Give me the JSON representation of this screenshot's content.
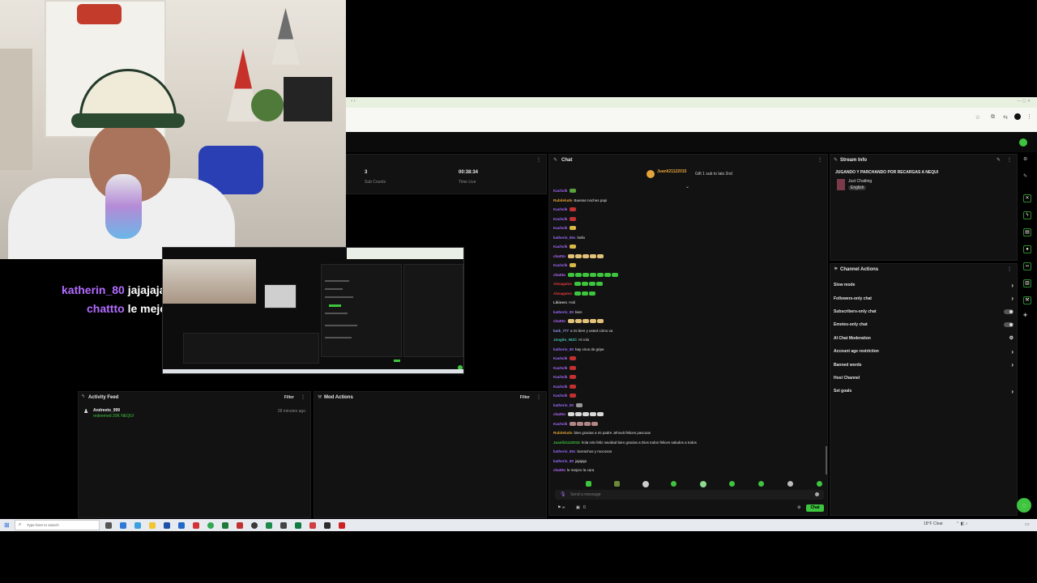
{
  "overlay_chat": [
    {
      "user": "katherin_80",
      "message": "jajajajaja"
    },
    {
      "user": "chattto",
      "message": "le mejoro la cara"
    }
  ],
  "stats": {
    "sub_count_value": "3",
    "sub_count_label": "Sub Counts",
    "time_live_value": "00:38:34",
    "time_live_label": "Time Live"
  },
  "chat": {
    "title": "Chat",
    "pinned_user": "Juanli21122015",
    "pinned_text": "Gift 1 sub to lats 2nd",
    "input_placeholder": "Send a message",
    "send_label": "Chat",
    "viewer_count": "0",
    "messages": [
      {
        "user": "Kachclk",
        "color": "#a66bff",
        "text": "",
        "emotes": [
          "#5aa33b"
        ]
      },
      {
        "user": "Rubiteludo",
        "color": "#e5a43a",
        "text": "Buenas noches papi",
        "emotes": []
      },
      {
        "user": "Kachclk",
        "color": "#a66bff",
        "text": "",
        "emotes": [
          "#c23030"
        ]
      },
      {
        "user": "Kachclk",
        "color": "#a66bff",
        "text": "",
        "emotes": [
          "#c23030"
        ]
      },
      {
        "user": "Kachclk",
        "color": "#a66bff",
        "text": "",
        "emotes": [
          "#d8b948"
        ]
      },
      {
        "user": "katherin_80c",
        "color": "#9a6cff",
        "text": "hello",
        "emotes": []
      },
      {
        "user": "Kachclk",
        "color": "#a66bff",
        "text": "",
        "emotes": [
          "#d8b948"
        ]
      },
      {
        "user": "chattto",
        "color": "#b36cff",
        "text": "",
        "emotes": [
          "#e2c27a",
          "#e2c27a",
          "#e2c27a",
          "#e2c27a",
          "#e2c27a"
        ]
      },
      {
        "user": "Kachclk",
        "color": "#a66bff",
        "text": "",
        "emotes": [
          "#d8b948"
        ]
      },
      {
        "user": "chattto",
        "color": "#b36cff",
        "text": "",
        "emotes": [
          "#3ec43e",
          "#3ec43e",
          "#3ec43e",
          "#3ec43e",
          "#3ec43e",
          "#3ec43e",
          "#3ec43e"
        ]
      },
      {
        "user": "Almagatos",
        "color": "#e53b3b",
        "text": "",
        "emotes": [
          "#3ec43e",
          "#3ec43e",
          "#3ec43e",
          "#3ec43e"
        ]
      },
      {
        "user": "Almagatos",
        "color": "#e53b3b",
        "text": "",
        "emotes": [
          "#3ec43e",
          "#3ec43e",
          "#3ec43e"
        ]
      },
      {
        "user": "Likinerc",
        "color": "#cccccc",
        "text": "Holi",
        "emotes": []
      },
      {
        "user": "katherin_80",
        "color": "#9a6cff",
        "text": "bien",
        "emotes": []
      },
      {
        "user": "chattto",
        "color": "#b36cff",
        "text": "",
        "emotes": [
          "#e2c27a",
          "#e2c27a",
          "#e2c27a",
          "#e2c27a",
          "#e2c27a"
        ]
      },
      {
        "user": "luck_777",
        "color": "#9aa0ff",
        "text": "a mi bien y usted cómo va",
        "emotes": []
      },
      {
        "user": "Jongito_NIZC",
        "color": "#43c7b8",
        "text": "Hi rolo",
        "emotes": []
      },
      {
        "user": "katherin_80",
        "color": "#9a6cff",
        "text": "hay virus de gripe",
        "emotes": []
      },
      {
        "user": "Kachclk",
        "color": "#a66bff",
        "text": "",
        "emotes": [
          "#c23030"
        ]
      },
      {
        "user": "Kachclk",
        "color": "#a66bff",
        "text": "",
        "emotes": [
          "#c23030"
        ]
      },
      {
        "user": "Kachclk",
        "color": "#a66bff",
        "text": "",
        "emotes": [
          "#c23030"
        ]
      },
      {
        "user": "Kachclk",
        "color": "#a66bff",
        "text": "",
        "emotes": [
          "#c23030"
        ]
      },
      {
        "user": "Kachclk",
        "color": "#a66bff",
        "text": "",
        "emotes": [
          "#c23030"
        ]
      },
      {
        "user": "katherin_80",
        "color": "#9a6cff",
        "text": "",
        "emotes": [
          "#999999"
        ]
      },
      {
        "user": "chattto",
        "color": "#b36cff",
        "text": "",
        "emotes": [
          "#d9d9d9",
          "#d9d9d9",
          "#d9d9d9",
          "#d9d9d9",
          "#d9d9d9"
        ]
      },
      {
        "user": "Kachclk",
        "color": "#a66bff",
        "text": "",
        "emotes": [
          "#b08585",
          "#b08585",
          "#b08585",
          "#b08585"
        ]
      },
      {
        "user": "Rubiteludo",
        "color": "#e5a43a",
        "text": "bien gracias a mi padre Jehová felices pascuas",
        "emotes": []
      },
      {
        "user": "Juanli21122015",
        "color": "#3ec43e",
        "text": "hola rolo feliz navidad bien gracias a Dios todos felices saludos a todos",
        "emotes": []
      },
      {
        "user": "katherin_80c",
        "color": "#9a6cff",
        "text": "borrachos y mocosos",
        "emotes": []
      },
      {
        "user": "katherin_80",
        "color": "#9a6cff",
        "text": "jajajaja",
        "emotes": []
      },
      {
        "user": "chattto",
        "color": "#b36cff",
        "text": "le mejoro la cara",
        "emotes": []
      }
    ]
  },
  "stream_info": {
    "title": "Stream Info",
    "stream_title": "JUGANDO Y PARCHANDO POR RECARGAS A NEQUI",
    "category": "Just Chatting",
    "language_tag": "English"
  },
  "channel_actions": {
    "title": "Channel Actions",
    "items": [
      {
        "label": "Slow mode",
        "control": "chevron"
      },
      {
        "label": "Followers-only chat",
        "control": "chevron"
      },
      {
        "label": "Subscribers-only chat",
        "control": "toggle"
      },
      {
        "label": "Emotes-only chat",
        "control": "toggle"
      },
      {
        "label": "AI Chat Moderation",
        "control": "settings"
      },
      {
        "label": "Account age restriction",
        "control": "chevron"
      },
      {
        "label": "Banned words",
        "control": "chevron"
      },
      {
        "label": "Host Channel",
        "control": "none"
      },
      {
        "label": "Set goals",
        "control": "chevron"
      }
    ]
  },
  "activity_feed": {
    "title": "Activity Feed",
    "filter_label": "Filter",
    "event_user": "Andreeto_999",
    "event_text": "redeemed 20K NEQUI",
    "event_time": "28 minutes ago"
  },
  "mod_actions": {
    "title": "Mod Actions",
    "filter_label": "Filter"
  },
  "taskbar": {
    "search_placeholder": "Type here to search",
    "weather": "18°F Clear"
  },
  "colors": {
    "accent_green": "#3ec43e",
    "panel_bg": "#121212",
    "overlay_user": "#b36cff"
  }
}
